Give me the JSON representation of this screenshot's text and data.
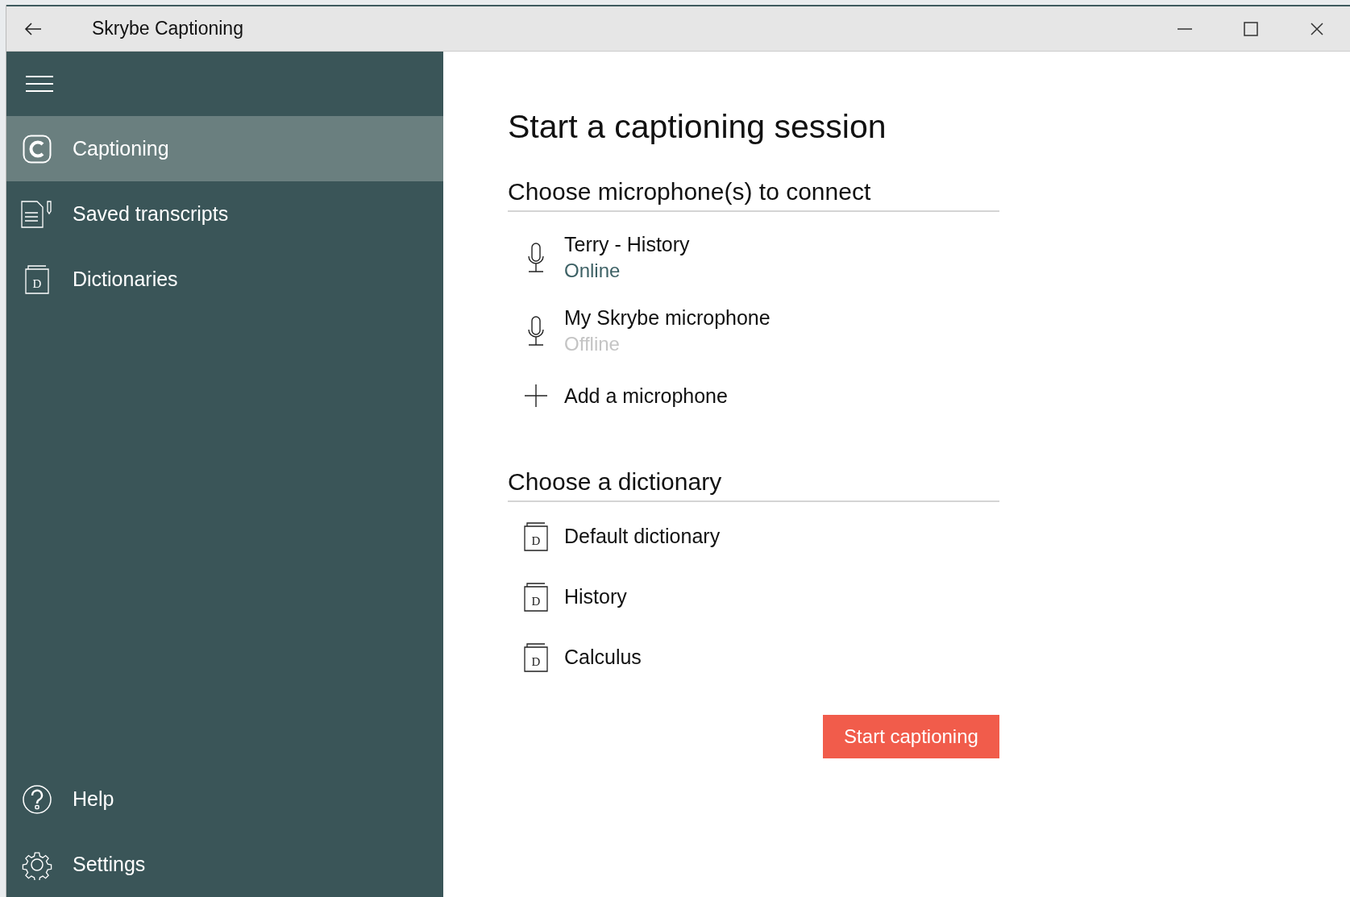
{
  "window": {
    "title": "Skrybe Captioning"
  },
  "sidebar": {
    "items": [
      {
        "label": "Captioning",
        "selected": true
      },
      {
        "label": "Saved transcripts",
        "selected": false
      },
      {
        "label": "Dictionaries",
        "selected": false,
        "icon_letter": "D"
      }
    ],
    "footer_items": [
      {
        "label": "Help"
      },
      {
        "label": "Settings"
      }
    ]
  },
  "main": {
    "title": "Start a captioning session",
    "microphones": {
      "heading": "Choose microphone(s) to connect",
      "items": [
        {
          "name": "Terry - History",
          "status": "Online",
          "online": true
        },
        {
          "name": "My Skrybe microphone",
          "status": "Offline",
          "online": false
        }
      ],
      "add_label": "Add a microphone"
    },
    "dictionaries": {
      "heading": "Choose a dictionary",
      "items": [
        {
          "name": "Default dictionary",
          "icon_letter": "D"
        },
        {
          "name": "History",
          "icon_letter": "D"
        },
        {
          "name": "Calculus",
          "icon_letter": "D"
        }
      ]
    },
    "start_button": "Start captioning"
  }
}
